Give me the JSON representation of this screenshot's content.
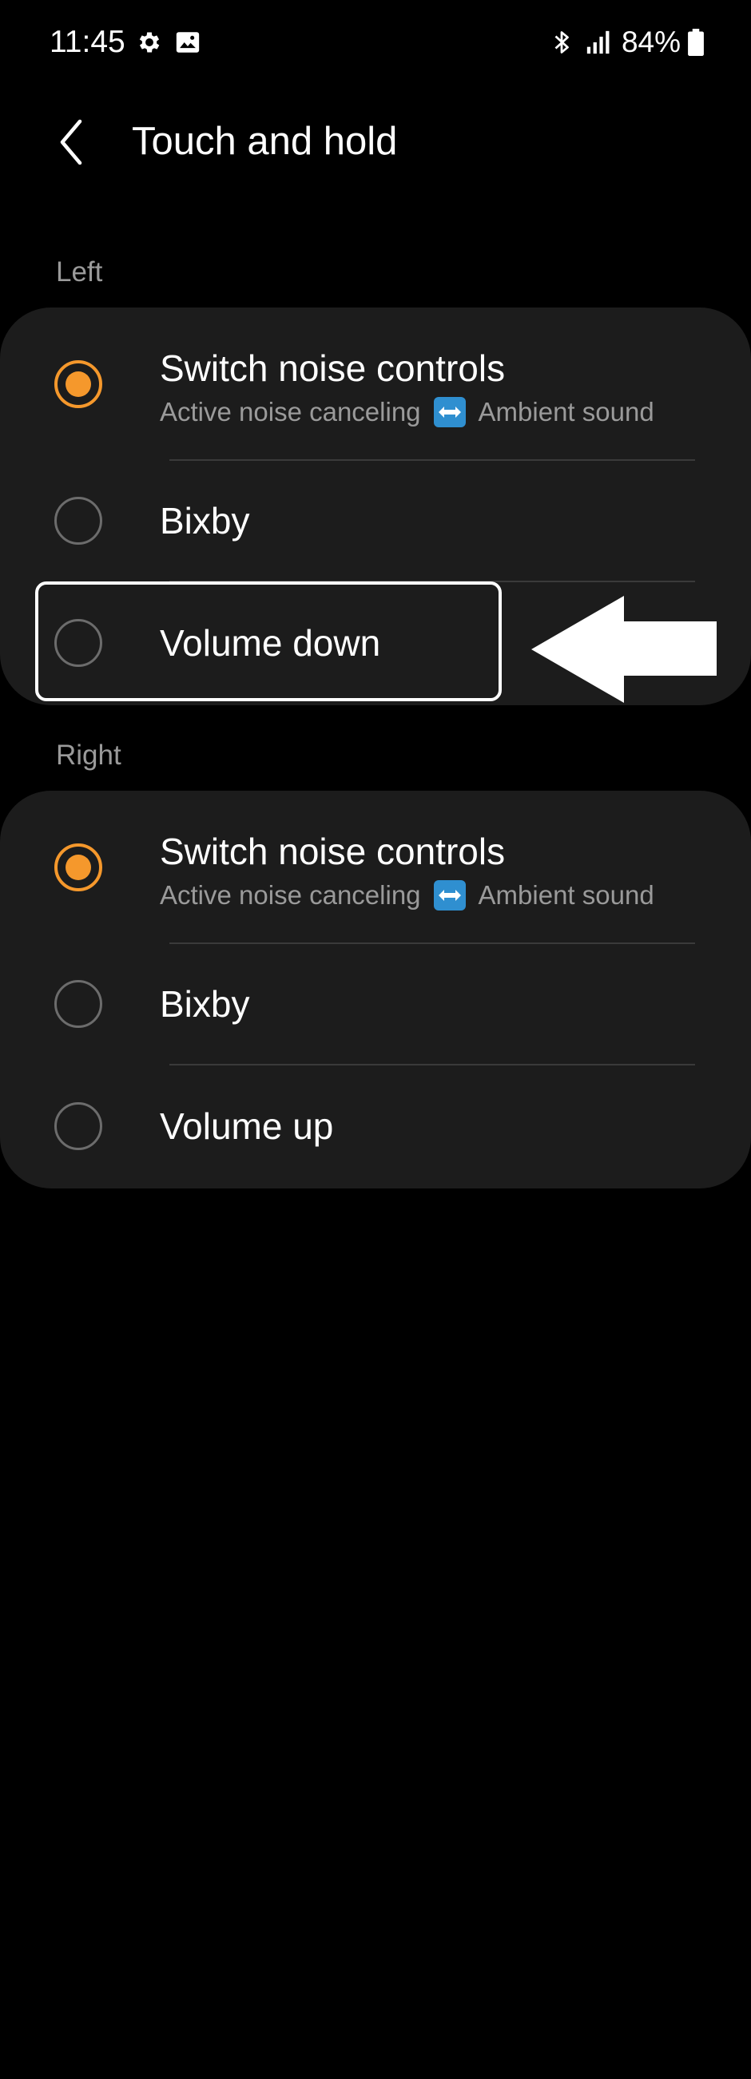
{
  "status_bar": {
    "time": "11:45",
    "battery": "84%",
    "icons": [
      "gear-icon",
      "image-icon",
      "bluetooth-icon",
      "signal-icon",
      "battery-icon"
    ]
  },
  "header": {
    "title": "Touch and hold",
    "back_icon": "chevron-left-icon"
  },
  "sections": [
    {
      "label": "Left",
      "options": [
        {
          "title": "Switch noise controls",
          "subtitle_left": "Active noise canceling",
          "subtitle_right": "Ambient sound",
          "selected": true
        },
        {
          "title": "Bixby",
          "selected": false
        },
        {
          "title": "Volume down",
          "selected": false,
          "highlighted": true
        }
      ]
    },
    {
      "label": "Right",
      "options": [
        {
          "title": "Switch noise controls",
          "subtitle_left": "Active noise canceling",
          "subtitle_right": "Ambient sound",
          "selected": true
        },
        {
          "title": "Bixby",
          "selected": false
        },
        {
          "title": "Volume up",
          "selected": false
        }
      ]
    }
  ],
  "colors": {
    "background": "#000000",
    "card": "#1c1c1c",
    "accent": "#f5982c",
    "secondary_text": "#9a9a9a",
    "divider": "#3a3a3a",
    "swap_emoji_bg": "#2f8fd0"
  },
  "annotation": {
    "arrow_icon": "arrow-left-icon",
    "highlight": "highlight-box"
  }
}
